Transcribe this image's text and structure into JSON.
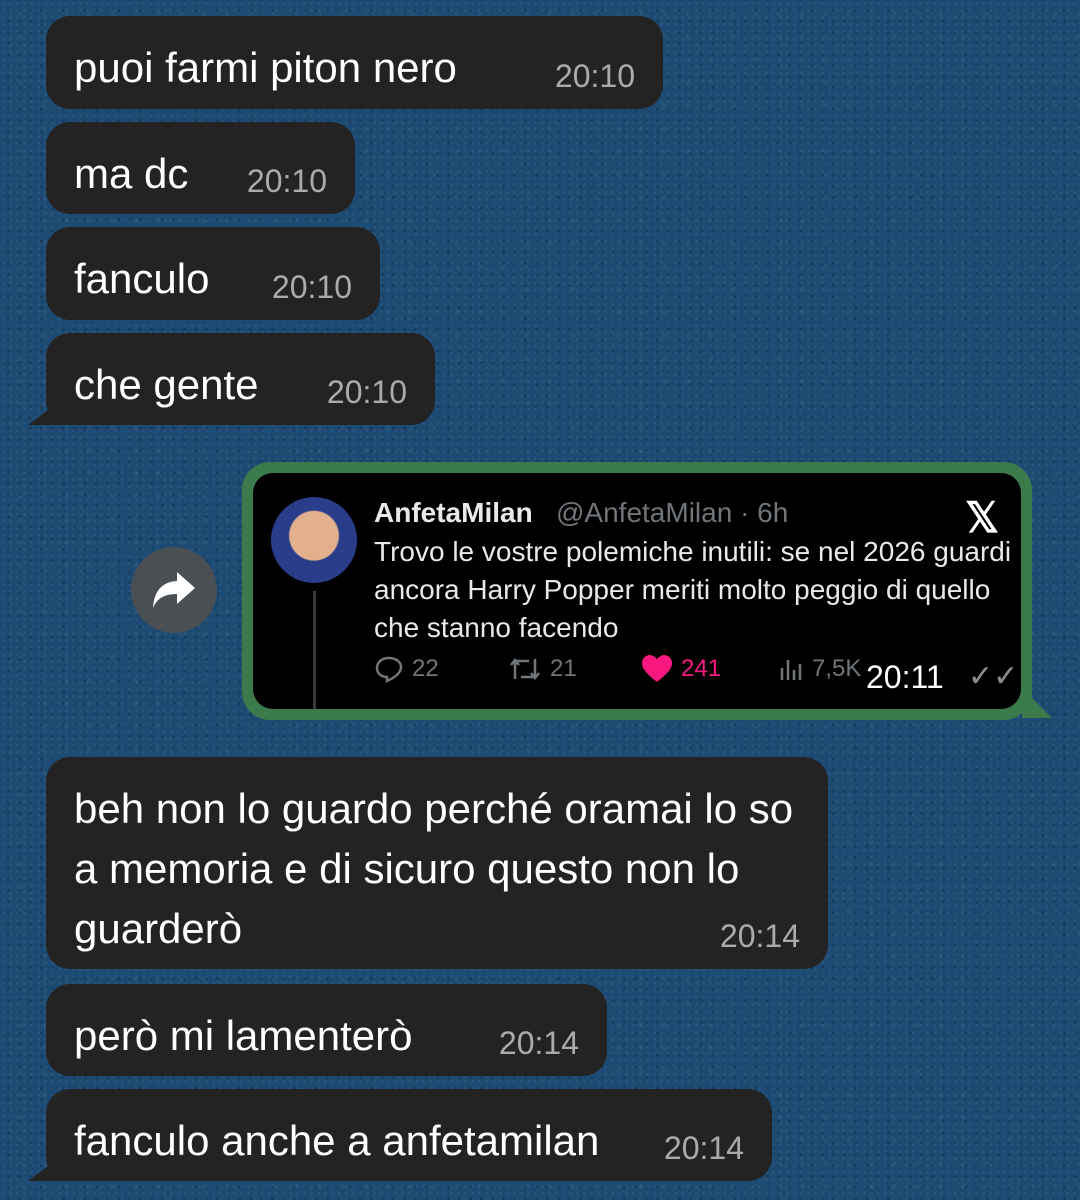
{
  "messages_before": [
    {
      "text": "puoi farmi piton nero",
      "time": "20:10"
    },
    {
      "text": "ma dc",
      "time": "20:10"
    },
    {
      "text": "fanculo",
      "time": "20:10"
    },
    {
      "text": "che gente",
      "time": "20:10"
    }
  ],
  "tweet": {
    "name": "AnfetaMilan",
    "handle": "@AnfetaMilan · 6h",
    "body": "Trovo le vostre polemiche inutili: se nel 2026 guardi ancora Harry Popper meriti molto peggio di quello che stanno facendo",
    "replies": "22",
    "retweets": "21",
    "likes": "241",
    "views": "7,5K",
    "time": "20:11",
    "icons": {
      "reply": "reply-icon",
      "retweet": "retweet-icon",
      "like": "heart-icon",
      "views": "views-icon",
      "brand": "x-logo-icon"
    },
    "like_color": "#f91880"
  },
  "messages_after": [
    {
      "text": "beh non lo guardo perché oramai lo so a memoria e di sicuro questo non lo guarderò",
      "time": "20:14"
    },
    {
      "text": "però mi lamenterò",
      "time": "20:14"
    },
    {
      "text": "fanculo anche a anfetamilan",
      "time": "20:14"
    }
  ],
  "colors": {
    "background": "#1c4a73",
    "bubble": "#232323",
    "forward_frame": "#3b7a4a"
  }
}
